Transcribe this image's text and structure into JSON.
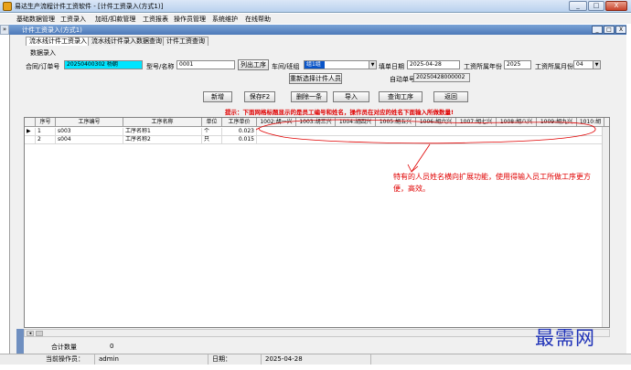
{
  "window": {
    "title": "易达生产流程计件工资软件 - [计件工资录入(方式1)]",
    "controls": [
      "_",
      "□",
      "X"
    ]
  },
  "menu": [
    "基础数据管理",
    "工资录入",
    "加班/扣款管理",
    "工资报表",
    "操作员管理",
    "系统维护",
    "在线帮助"
  ],
  "mdi": {
    "title": "计件工资录入(方式1)",
    "left_button": "»",
    "controls": [
      "_",
      "□",
      "X"
    ]
  },
  "tabs": [
    "流水线计件工资录入",
    "流水线计件录入数据查询",
    "计件工资查询"
  ],
  "section_label": "数据录入",
  "form": {
    "order_label": "合同/订单号",
    "order_value": "20250400302 杨朝",
    "model_label": "型号/名称",
    "model_value": "0001",
    "list_process_button": "列出工序",
    "workshop_label": "车间/班组",
    "workshop_value": "组1组",
    "fill_date_label": "填单日期",
    "fill_date_value": "2025-04-28",
    "year_label": "工资所属年份",
    "year_value": "2025",
    "month_label": "工资所属月份",
    "month_value": "04",
    "reselect_button": "重新选择计件人员",
    "auto_no_label": "自动单号",
    "auto_no_value": "20250428000002"
  },
  "buttons": {
    "add": "新增",
    "save": "保存F2",
    "delete": "删除一条",
    "import": "导入",
    "query": "查询工序",
    "back": "返回"
  },
  "hint": "提示：下面网格标题显示的是员工编号和姓名，操作员在对应的姓名下面输入所做数量!",
  "grid": {
    "columns": [
      "序号",
      "工序编号",
      "工序名称",
      "单位",
      "工序单价",
      "1002:胡一兴",
      "1003:胡三兴",
      "1004:胡四兴",
      "1005:胡五兴",
      "1006:胡六兴",
      "1007:胡七兴",
      "1008:胡八兴",
      "1009:胡九兴",
      "1010:胡"
    ],
    "rows": [
      {
        "no": "1",
        "code": "s003",
        "name": "工序名称1",
        "unit": "个",
        "price": "0.023"
      },
      {
        "no": "2",
        "code": "s004",
        "name": "工序名称2",
        "unit": "只",
        "price": "0.015"
      }
    ]
  },
  "annotation": "特有的人员姓名横向扩展功能，使用得输入员工所做工序更方便，高效。",
  "watermark": "最需网",
  "footer": {
    "total_label": "合计数量",
    "total_value": "0",
    "operator_label": "当前操作员：",
    "operator_value": "admin",
    "date_label": "日期：",
    "date_value": "2025-04-28"
  },
  "colors": {
    "highlight_field": "#00e5ff",
    "selected_field": "#0a55c8",
    "hint_red": "#e00000",
    "watermark_blue": "#1f32b8"
  }
}
